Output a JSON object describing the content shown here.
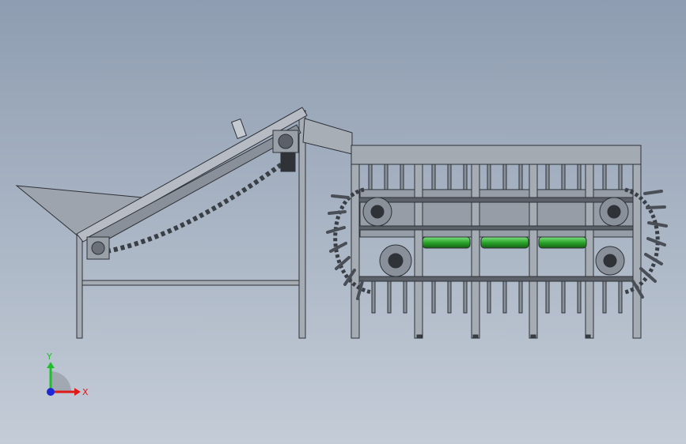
{
  "viewport": {
    "background_top": "#8e9db1",
    "background_bottom": "#c4ccd7"
  },
  "model": {
    "feed_conveyor": {
      "hopper": "hopper",
      "belt": "inclined-conveyor",
      "motor": "gear-motor"
    },
    "harvester_unit": {
      "green_rollers": 3,
      "roller_color": "#2aa52a",
      "sprockets": 4
    }
  },
  "triad": {
    "y_label": "Y",
    "x_label": "X",
    "y_color": "#1fbf2c",
    "x_color": "#e01919",
    "z_color": "#1c27d8"
  }
}
